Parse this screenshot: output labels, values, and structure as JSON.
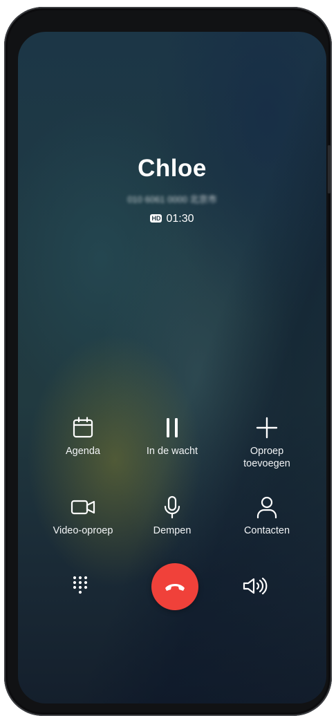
{
  "call": {
    "caller_name": "Chloe",
    "caller_number": "010 6061 0000 北京市",
    "hd_badge": "HD",
    "timer": "01:30"
  },
  "actions": [
    {
      "id": "calendar",
      "label": "Agenda",
      "icon": "calendar-icon"
    },
    {
      "id": "hold",
      "label": "In de wacht",
      "icon": "pause-icon"
    },
    {
      "id": "add_call",
      "label": "Oproep toevoegen",
      "icon": "plus-icon"
    },
    {
      "id": "video_call",
      "label": "Video-oproep",
      "icon": "video-camera-icon"
    },
    {
      "id": "mute",
      "label": "Dempen",
      "icon": "microphone-icon"
    },
    {
      "id": "contacts",
      "label": "Contacten",
      "icon": "person-icon"
    }
  ],
  "bottom": {
    "dialpad_icon": "dialpad-icon",
    "end_call_icon": "hang-up-icon",
    "speaker_icon": "speaker-icon"
  },
  "colors": {
    "end_call": "#f0413a",
    "foreground": "#ffffff"
  }
}
